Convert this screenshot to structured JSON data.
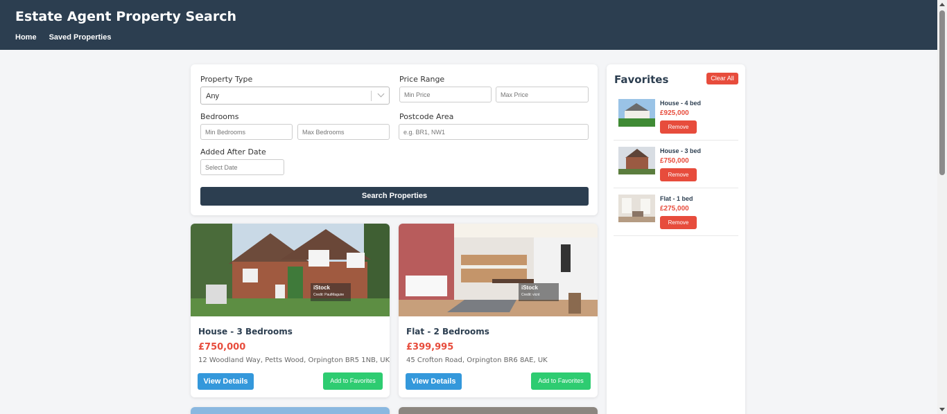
{
  "header": {
    "title": "Estate Agent Property Search",
    "nav": [
      "Home",
      "Saved Properties"
    ]
  },
  "search": {
    "property_type_label": "Property Type",
    "property_type_value": "Any",
    "price_range_label": "Price Range",
    "min_price_placeholder": "Min Price",
    "max_price_placeholder": "Max Price",
    "bedrooms_label": "Bedrooms",
    "min_bedrooms_placeholder": "Min Bedrooms",
    "max_bedrooms_placeholder": "Max Bedrooms",
    "postcode_label": "Postcode Area",
    "postcode_placeholder": "e.g. BR1, NW1",
    "date_label": "Added After Date",
    "date_placeholder": "Select Date",
    "search_button": "Search Properties"
  },
  "properties": [
    {
      "title": "House - 3 Bedrooms",
      "price": "£750,000",
      "address": "12 Woodland Way, Petts Wood, Orpington BR5 1NB, UK",
      "view_label": "View Details",
      "fav_label": "Add to Favorites",
      "watermark": "iStock",
      "watermark_credit": "Credit: PaulMaguire"
    },
    {
      "title": "Flat - 2 Bedrooms",
      "price": "£399,995",
      "address": "45 Crofton Road, Orpington BR6 8AE, UK",
      "view_label": "View Details",
      "fav_label": "Add to Favorites",
      "watermark": "iStock",
      "watermark_credit": "Credit: vicnt"
    }
  ],
  "favorites": {
    "title": "Favorites",
    "clear_label": "Clear All",
    "items": [
      {
        "name": "House - 4 bed",
        "price": "£925,000",
        "remove_label": "Remove"
      },
      {
        "name": "House - 3 bed",
        "price": "£750,000",
        "remove_label": "Remove"
      },
      {
        "name": "Flat - 1 bed",
        "price": "£275,000",
        "remove_label": "Remove"
      }
    ]
  },
  "colors": {
    "header": "#2c3e50",
    "price": "#e74c3c",
    "view_button": "#3498db",
    "favorite_button": "#2ecc71",
    "remove_button": "#e74c3c"
  }
}
